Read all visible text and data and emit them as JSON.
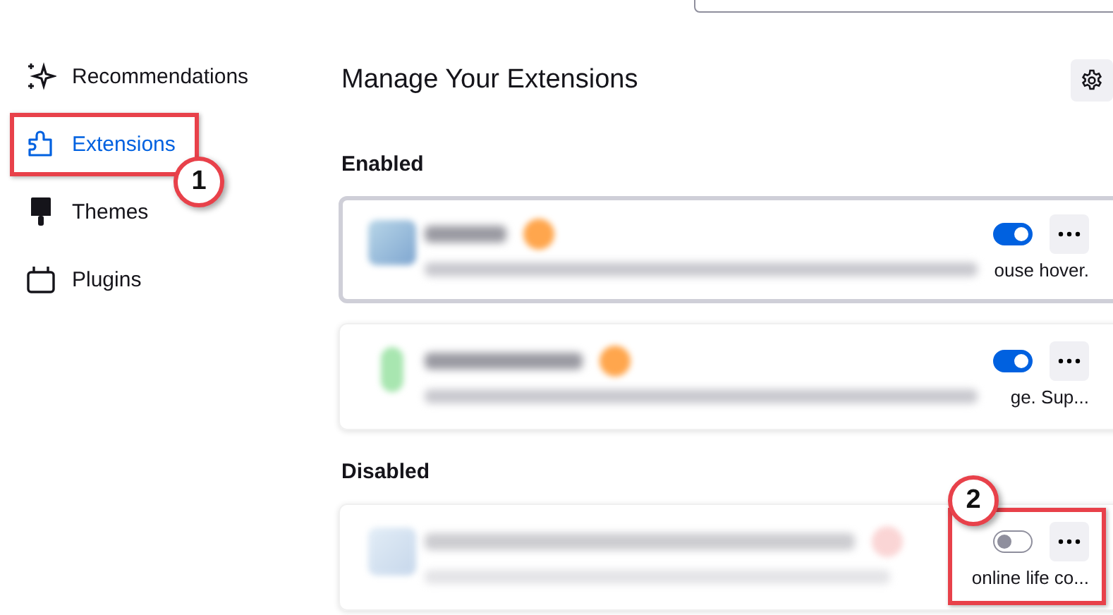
{
  "sidebar": {
    "items": [
      {
        "label": "Recommendations",
        "selected": false
      },
      {
        "label": "Extensions",
        "selected": true
      },
      {
        "label": "Themes",
        "selected": false
      },
      {
        "label": "Plugins",
        "selected": false
      }
    ]
  },
  "heading": "Manage Your Extensions",
  "sections": [
    {
      "title": "Enabled",
      "extensions": [
        {
          "description_tail": "ouse hover.",
          "enabled": true,
          "focused": true
        },
        {
          "description_tail": "ge. Sup...",
          "enabled": true,
          "focused": false
        }
      ]
    },
    {
      "title": "Disabled",
      "extensions": [
        {
          "description_tail": "online life co...",
          "enabled": false,
          "focused": false
        }
      ]
    }
  ],
  "annotations": [
    {
      "label": "1"
    },
    {
      "label": "2"
    }
  ]
}
